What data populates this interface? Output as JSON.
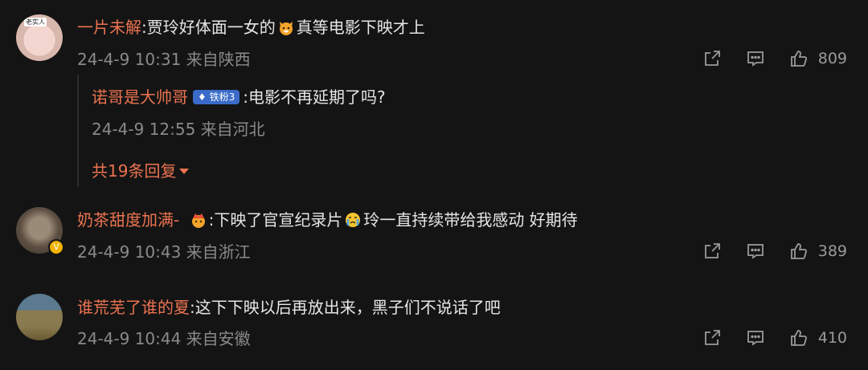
{
  "comments": [
    {
      "username": "一片未解",
      "text_before": ":贾玲好体面一女的",
      "text_after": "真等电影下映才上",
      "emoji": "cat-face-emoji",
      "avatar_tag": "老实人",
      "meta": "24-4-9 10:31 来自陕西",
      "likes": "809",
      "reply": {
        "username": "诺哥是大帅哥",
        "badge": "铁粉3",
        "text": ":电影不再延期了吗?",
        "meta": "24-4-9 12:55 来自河北"
      },
      "expand_label": "共19条回复"
    },
    {
      "username": "奶茶甜度加满-",
      "text_before": ":下映了官宣纪录片",
      "text_after": "玲一直持续带给我感动 好期待",
      "emoji": "crying-face-emoji",
      "badge_emoji": "crown-emoji",
      "verified": "V",
      "meta": "24-4-9 10:43 来自浙江",
      "likes": "389"
    },
    {
      "username": "谁荒芜了谁的夏",
      "text": ":这下下映以后再放出来，黑子们不说话了吧",
      "meta": "24-4-9 10:44 来自安徽",
      "likes": "410"
    }
  ],
  "colors": {
    "username": "#eb7350",
    "background": "#141414",
    "meta": "#8a8a8a"
  }
}
